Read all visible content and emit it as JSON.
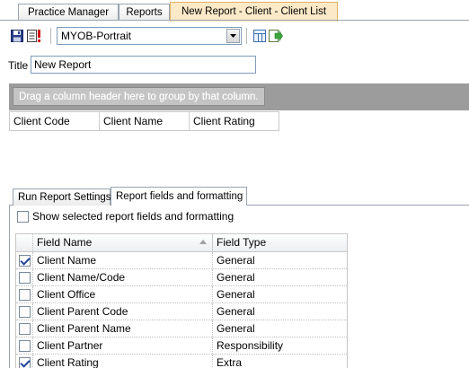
{
  "top_tabs": [
    {
      "label": "Practice Manager"
    },
    {
      "label": "Reports"
    },
    {
      "label": "New Report - Client - Client List",
      "active": true
    }
  ],
  "toolbar": {
    "save_icon": "save-icon",
    "report_icon": "report-alert-icon",
    "layout_value": "MYOB-Portrait",
    "chevron_icon": "chevron-down-icon",
    "button_a_icon": "columns-icon",
    "button_b_icon": "export-icon"
  },
  "title": {
    "label": "Title",
    "value": "New Report"
  },
  "group_panel": {
    "hint": "Drag a column header here to group by that column."
  },
  "grid_columns": [
    "Client Code",
    "Client Name",
    "Client Rating"
  ],
  "lower_tabs": [
    {
      "label": "Run Report Settings"
    },
    {
      "label": "Report fields and formatting",
      "active": true
    }
  ],
  "show_selected": {
    "label": "Show selected report fields and formatting",
    "checked": false
  },
  "fields_table": {
    "columns": [
      "Field Name",
      "Field Type"
    ],
    "rows": [
      {
        "checked": true,
        "name": "Client Name",
        "type": "General"
      },
      {
        "checked": false,
        "name": "Client Name/Code",
        "type": "General"
      },
      {
        "checked": false,
        "name": "Client Office",
        "type": "General"
      },
      {
        "checked": false,
        "name": "Client Parent Code",
        "type": "General"
      },
      {
        "checked": false,
        "name": "Client Parent Name",
        "type": "General"
      },
      {
        "checked": false,
        "name": "Client Partner",
        "type": "Responsibility"
      },
      {
        "checked": true,
        "name": "Client Rating",
        "type": "Extra"
      }
    ]
  },
  "colors": {
    "active_tab": "#fbe9c8",
    "group_panel_bg": "#9c9c9c",
    "check_color": "#21449b"
  }
}
